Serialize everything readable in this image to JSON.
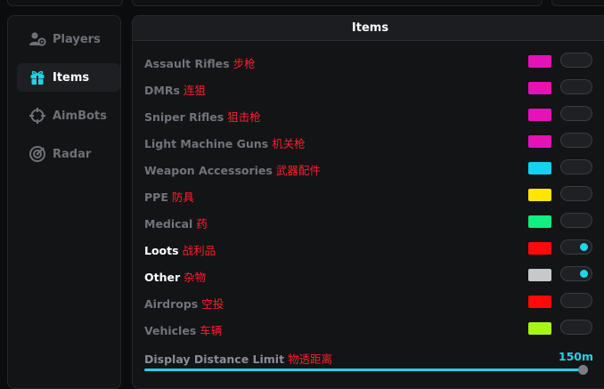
{
  "nav": [
    {
      "label": "Players",
      "icon": "players-settings-icon",
      "active": false
    },
    {
      "label": "Items",
      "icon": "gift-box-icon",
      "active": true
    },
    {
      "label": "AimBots",
      "icon": "crosshair-icon",
      "active": false
    },
    {
      "label": "Radar",
      "icon": "radar-icon",
      "active": false
    }
  ],
  "panel": {
    "title": "Items",
    "items": [
      {
        "label": "Assault Rifles",
        "cn": "步枪",
        "color": "#e612b8",
        "enabled": false
      },
      {
        "label": "DMRs",
        "cn": "连狙",
        "color": "#e612b8",
        "enabled": false
      },
      {
        "label": "Sniper Rifles",
        "cn": "狙击枪",
        "color": "#e612b8",
        "enabled": false
      },
      {
        "label": "Light Machine Guns",
        "cn": "机关枪",
        "color": "#e612b8",
        "enabled": false
      },
      {
        "label": "Weapon Accessories",
        "cn": "武器配件",
        "color": "#15d0f2",
        "enabled": false
      },
      {
        "label": "PPE",
        "cn": "防具",
        "color": "#ffe600",
        "enabled": false
      },
      {
        "label": "Medical",
        "cn": "药",
        "color": "#10ef82",
        "enabled": false
      },
      {
        "label": "Loots",
        "cn": "战利品",
        "color": "#ff0a0a",
        "enabled": true
      },
      {
        "label": "Other",
        "cn": "杂物",
        "color": "#c8c8c8",
        "enabled": true
      },
      {
        "label": "Airdrops",
        "cn": "空投",
        "color": "#ff0a0a",
        "enabled": false
      },
      {
        "label": "Vehicles",
        "cn": "车辆",
        "color": "#a6f512",
        "enabled": false
      }
    ],
    "distance": {
      "label": "Display Distance Limit",
      "cn": "物透距离",
      "value": "150m",
      "fraction": 1.0
    }
  },
  "colors": {
    "accent": "#22d3e6",
    "cn_text": "#ff1e2d"
  }
}
